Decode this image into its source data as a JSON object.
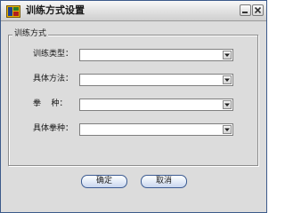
{
  "window": {
    "title": "训练方式设置"
  },
  "group": {
    "legend": "训练方式"
  },
  "fields": [
    {
      "label": "训练类型：",
      "value": ""
    },
    {
      "label": "具体方法：",
      "value": ""
    },
    {
      "label": "拳    种：",
      "value": ""
    },
    {
      "label": "具体拳种：",
      "value": ""
    }
  ],
  "buttons": {
    "ok": "确定",
    "cancel": "取消"
  },
  "colors": {
    "window_bg": "#dcdcdc",
    "button_border": "#3b5b92"
  }
}
